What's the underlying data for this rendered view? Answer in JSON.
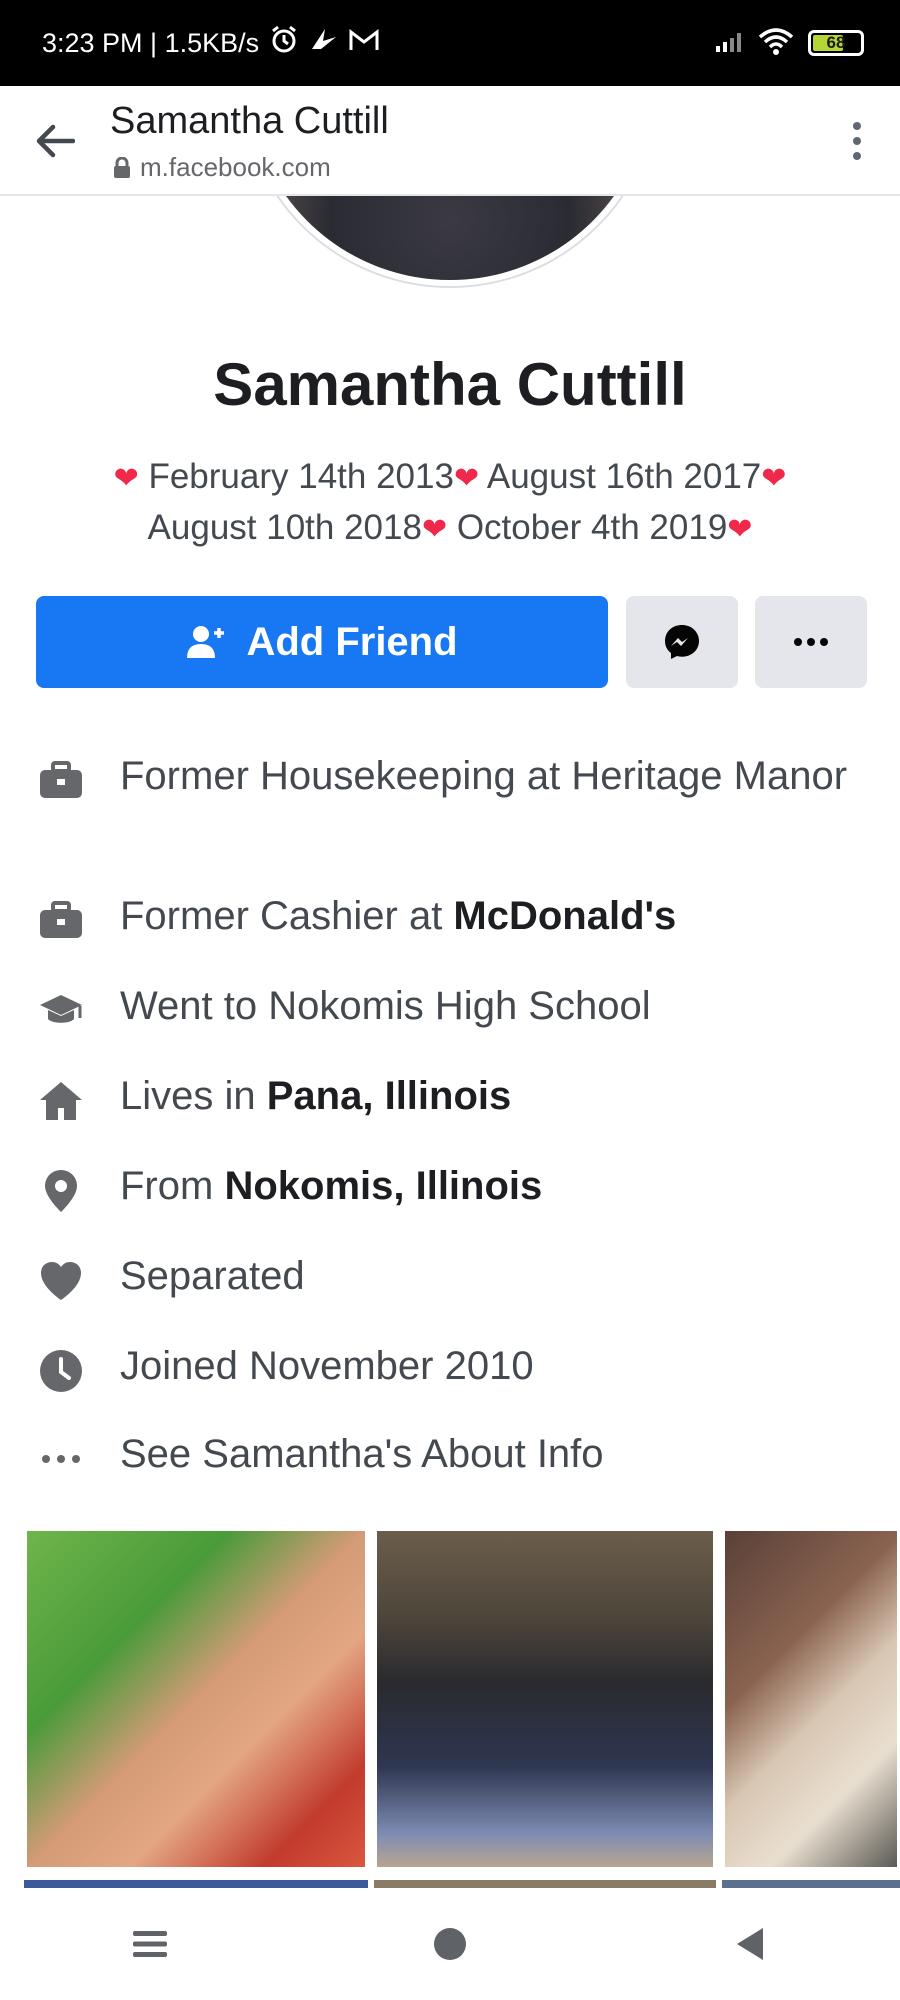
{
  "status_bar": {
    "time_speed": "3:23 PM | 1.5KB/s",
    "battery_level": "68",
    "battery_color": "#b5d736"
  },
  "browser": {
    "title": "Samantha Cuttill",
    "url": "m.facebook.com"
  },
  "profile": {
    "name": "Samantha Cuttill",
    "bio_dates": [
      "February 14th 2013",
      "August 16th 2017",
      "August 10th 2018",
      "October 4th 2019"
    ],
    "bio_symbol": "❤"
  },
  "actions": {
    "add_friend_label": "Add Friend",
    "primary_color": "#1877f2"
  },
  "info": {
    "work1": {
      "prefix": "Former Housekeeping at Heritage Manor",
      "icon": "briefcase-icon"
    },
    "work2": {
      "prefix": "Former Cashier at ",
      "bold": "McDonald's",
      "icon": "briefcase-icon"
    },
    "education": {
      "text": "Went to Nokomis High School",
      "icon": "graduation-cap-icon"
    },
    "lives": {
      "prefix": "Lives in ",
      "bold": "Pana, Illinois",
      "icon": "home-icon"
    },
    "from": {
      "prefix": "From ",
      "bold": "Nokomis, Illinois",
      "icon": "location-pin-icon"
    },
    "relationship": {
      "text": "Separated",
      "icon": "heart-icon"
    },
    "joined": {
      "text": "Joined November 2010",
      "icon": "clock-icon"
    },
    "about": {
      "text": "See Samantha's About Info",
      "icon": "more-dots-icon"
    }
  },
  "icons": {
    "status": [
      "alarm-icon",
      "bird-icon",
      "gmail-icon",
      "signal-icon",
      "wifi-icon",
      "battery-icon"
    ],
    "nav": [
      "menu-icon",
      "home-circle-icon",
      "back-triangle-icon"
    ]
  }
}
